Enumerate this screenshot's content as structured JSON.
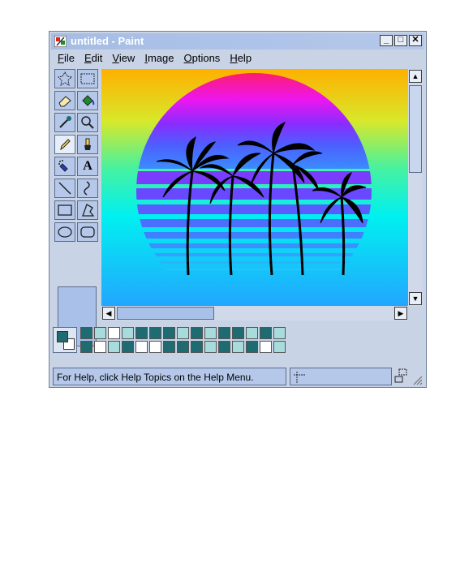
{
  "window": {
    "title": "untitled - Paint"
  },
  "title_buttons": {
    "minimize": "_",
    "maximize": "□",
    "close": "✕"
  },
  "menu": [
    {
      "label": "File",
      "accel": "F",
      "rest": "ile"
    },
    {
      "label": "Edit",
      "accel": "E",
      "rest": "dit"
    },
    {
      "label": "View",
      "accel": "V",
      "rest": "iew"
    },
    {
      "label": "Image",
      "accel": "I",
      "rest": "mage"
    },
    {
      "label": "Options",
      "accel": "O",
      "rest": "ptions"
    },
    {
      "label": "Help",
      "accel": "H",
      "rest": "elp"
    }
  ],
  "tools": [
    "free-form-select-icon",
    "rect-select-icon",
    "eraser-icon",
    "fill-bucket-icon",
    "color-picker-icon",
    "magnifier-icon",
    "pencil-icon",
    "brush-icon",
    "airbrush-icon",
    "text-icon",
    "line-icon",
    "curve-icon",
    "rectangle-icon",
    "polygon-icon",
    "ellipse-icon",
    "rounded-rect-icon"
  ],
  "tools_text_label": "A",
  "active_tool": "pencil-icon",
  "colors": {
    "foreground": "#1f6b72",
    "background": "#ffffff",
    "palette_top": [
      "#1f6b72",
      "#a8dcdc",
      "#ffffff",
      "#a8dcdc",
      "#1f6b72",
      "#1f6b72",
      "#1f6b72",
      "#a8dcdc",
      "#1f6b72",
      "#a8dcdc",
      "#1f6b72",
      "#1f6b72",
      "#a8dcdc",
      "#1f6b72",
      "#a8dcdc"
    ],
    "palette_bottom": [
      "#1f6b72",
      "#ffffff",
      "#a8dcdc",
      "#1f6b72",
      "#ffffff",
      "#ffffff",
      "#1f6b72",
      "#1f6b72",
      "#1f6b72",
      "#a8dcdc",
      "#1f6b72",
      "#a8dcdc",
      "#1f6b72",
      "#ffffff",
      "#a8dcdc"
    ]
  },
  "status": {
    "help_text": "For Help, click Help Topics on the Help Menu."
  }
}
